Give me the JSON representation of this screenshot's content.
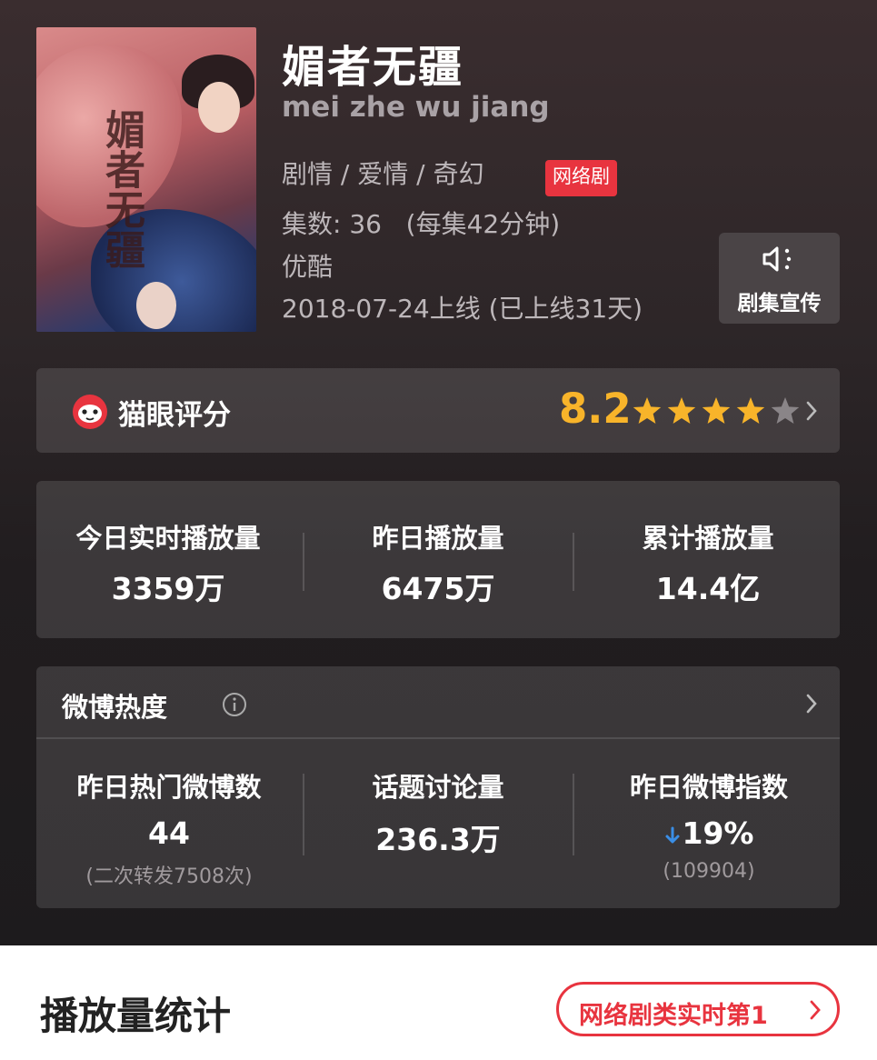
{
  "show": {
    "title": "媚者无疆",
    "pinyin": "mei zhe wu jiang",
    "genres": "剧情 / 爱情 / 奇幻",
    "badge": "网络剧",
    "episodes": "集数: 36   (每集42分钟)",
    "platform": "优酷",
    "release": "2018-07-24上线 (已上线31天)",
    "poster_text": "媚者无疆"
  },
  "promo_button": {
    "label": "剧集宣传",
    "icon": "speaker-icon"
  },
  "rating": {
    "label": "猫眼评分",
    "score": "8.2",
    "stars_out_of_5": 4,
    "icon": "maoyan-cat-icon"
  },
  "play_stats": [
    {
      "label": "今日实时播放量",
      "value": "3359万"
    },
    {
      "label": "昨日播放量",
      "value": "6475万"
    },
    {
      "label": "累计播放量",
      "value": "14.4亿"
    }
  ],
  "weibo": {
    "title": "微博热度",
    "stats": [
      {
        "label": "昨日热门微博数",
        "value": "44",
        "sub": "(二次转发7508次)"
      },
      {
        "label": "话题讨论量",
        "value": "236.3万",
        "sub": ""
      },
      {
        "label": "昨日微博指数",
        "value": "19%",
        "sub": "(109904)",
        "trend": "down"
      }
    ]
  },
  "section": {
    "title": "播放量统计",
    "rank_pill": "网络剧类实时第1"
  },
  "colors": {
    "accent_red": "#e8343f",
    "score_yellow": "#f8b42a",
    "trend_down_blue": "#3a8ee6"
  }
}
